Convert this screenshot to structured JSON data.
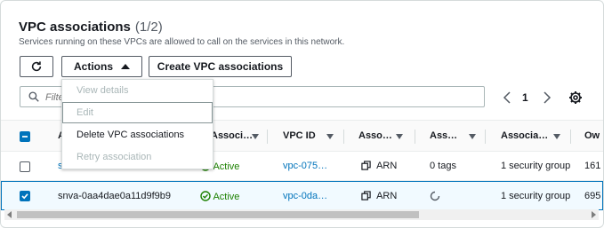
{
  "header": {
    "title": "VPC associations",
    "count": "(1/2)",
    "description": "Services running on these VPCs are allowed to call on the services in this network."
  },
  "toolbar": {
    "refresh_icon": "refresh-icon",
    "actions_label": "Actions",
    "create_label": "Create VPC associations"
  },
  "actions_menu": {
    "items": [
      {
        "label": "View details",
        "state": "disabled"
      },
      {
        "label": "Edit",
        "state": "disabled"
      },
      {
        "label": "Delete VPC associations",
        "state": "enabled"
      },
      {
        "label": "Retry association",
        "state": "disabled"
      }
    ]
  },
  "search": {
    "placeholder": "Filter"
  },
  "pagination": {
    "current_page": "1"
  },
  "table": {
    "columns": [
      {
        "label": "A"
      },
      {
        "label": "Associ…"
      },
      {
        "label": "VPC ID"
      },
      {
        "label": "Asso…"
      },
      {
        "label": "Ass…"
      },
      {
        "label": "Associa…"
      },
      {
        "label": "Ow"
      }
    ],
    "rows": [
      {
        "selected": false,
        "name": "s",
        "status": "Active",
        "vpc_id": "vpc-075…",
        "arn": "ARN",
        "tags": "0 tags",
        "security_groups": "1 security group",
        "owner": "161"
      },
      {
        "selected": true,
        "name": "snva-0aa4dae0a11d9f9b9",
        "status": "Active",
        "vpc_id": "vpc-0da…",
        "arn": "ARN",
        "tags": "",
        "security_groups": "1 security group",
        "owner": "695"
      }
    ]
  },
  "colors": {
    "link": "#0073bb",
    "active_status": "#1d8102",
    "selected_row_bg": "#f1faff",
    "disabled_text": "#aab7b8"
  }
}
